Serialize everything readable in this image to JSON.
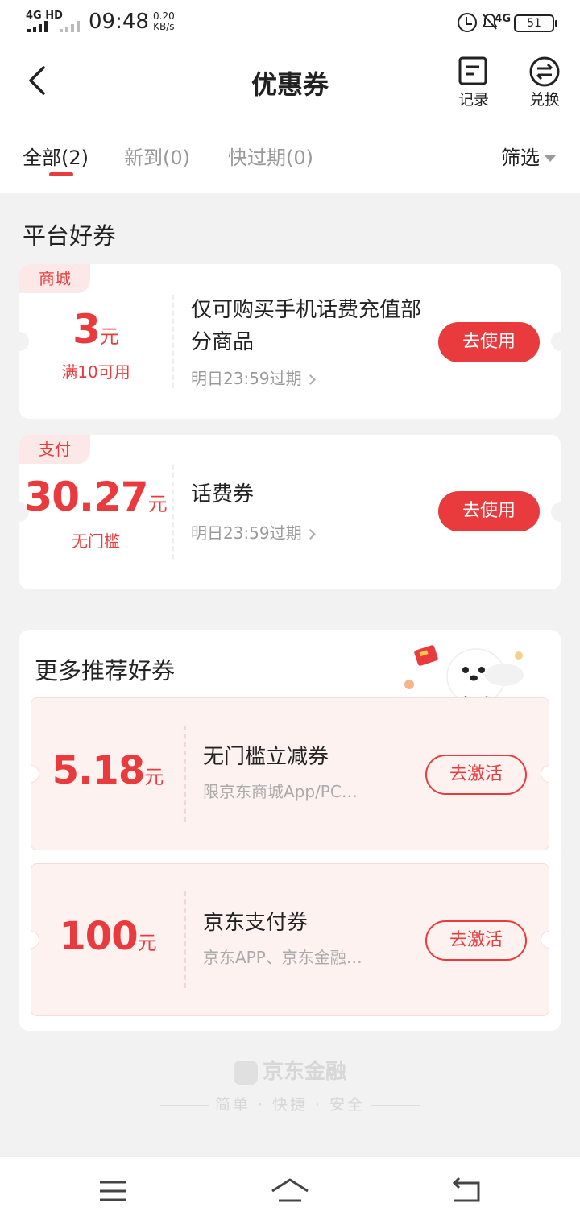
{
  "status_bar": {
    "network": "4G HD",
    "time": "09:48",
    "speed_value": "0.20",
    "speed_unit": "KB/s",
    "network_right": "4G",
    "battery": "51"
  },
  "header": {
    "title": "优惠券",
    "record_label": "记录",
    "exchange_label": "兑换"
  },
  "tabs": [
    {
      "label": "全部(2)",
      "active": true
    },
    {
      "label": "新到(0)",
      "active": false
    },
    {
      "label": "快过期(0)",
      "active": false
    }
  ],
  "filter_label": "筛选",
  "platform_section": {
    "title": "平台好券",
    "coupons": [
      {
        "tag": "商城",
        "amount": "3",
        "unit": "元",
        "condition": "满10可用",
        "title": "仅可购买手机话费充值部分商品",
        "expire": "明日23:59过期",
        "button": "去使用"
      },
      {
        "tag": "支付",
        "amount": "30.27",
        "unit": "元",
        "condition": "无门槛",
        "title": "话费券",
        "expire": "明日23:59过期",
        "button": "去使用"
      }
    ]
  },
  "recommend_section": {
    "title": "更多推荐好券",
    "coupons": [
      {
        "amount": "5.18",
        "unit": "元",
        "title": "无门槛立减券",
        "desc": "限京东商城App/PC…",
        "button": "去激活"
      },
      {
        "amount": "100",
        "unit": "元",
        "title": "京东支付券",
        "desc": "京东APP、京东金融…",
        "button": "去激活"
      }
    ]
  },
  "footer": {
    "brand": "京东金融",
    "slogan": "简单 · 快捷 · 安全"
  },
  "colors": {
    "accent": "#e93b3d",
    "tag_bg": "#fde8e8",
    "rec_card_bg": "#fdf2f0",
    "page_bg": "#f2f2f2"
  },
  "icons": [
    "back-icon",
    "record-icon",
    "exchange-icon",
    "menu-icon",
    "home-icon",
    "return-icon",
    "alarm-icon",
    "mute-bell-icon"
  ]
}
